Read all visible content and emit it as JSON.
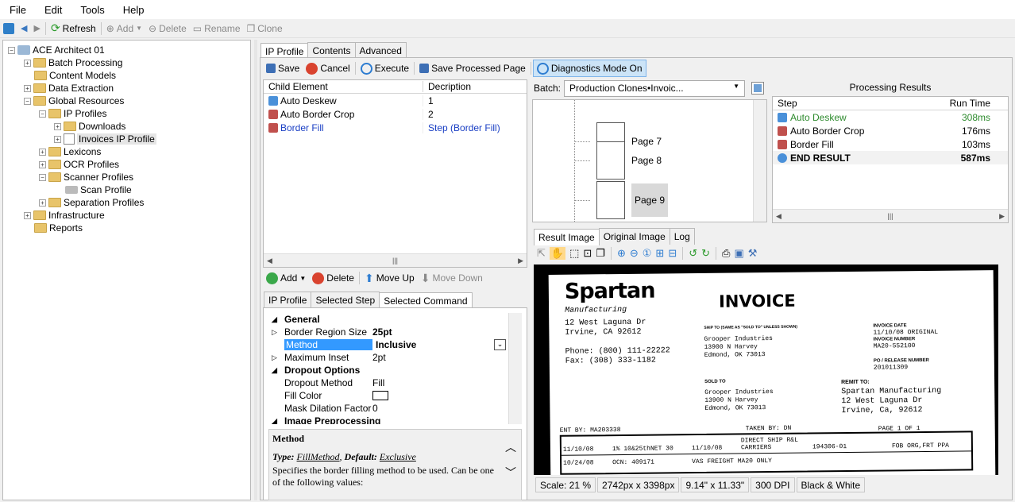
{
  "menu": [
    "File",
    "Edit",
    "Tools",
    "Help"
  ],
  "toolbar": {
    "refresh": "Refresh",
    "add": "Add",
    "delete": "Delete",
    "rename": "Rename",
    "clone": "Clone"
  },
  "tree": {
    "root": "ACE Architect 01",
    "batch": "Batch Processing",
    "content": "Content Models",
    "extraction": "Data Extraction",
    "global": "Global Resources",
    "ipprofiles": "IP Profiles",
    "downloads": "Downloads",
    "invoices": "Invoices IP Profile",
    "lexicons": "Lexicons",
    "ocr": "OCR Profiles",
    "scanner": "Scanner Profiles",
    "scan": "Scan Profile",
    "separation": "Separation Profiles",
    "infra": "Infrastructure",
    "reports": "Reports"
  },
  "main_tabs": [
    "IP Profile",
    "Contents",
    "Advanced"
  ],
  "cmd": {
    "save": "Save",
    "cancel": "Cancel",
    "execute": "Execute",
    "saveproc": "Save Processed Page",
    "diag": "Diagnostics Mode On"
  },
  "steps": {
    "h1": "Child Element",
    "h2": "Decription",
    "rows": [
      [
        "Auto Deskew",
        "1"
      ],
      [
        "Auto Border Crop",
        "2"
      ],
      [
        "Border Fill",
        "Step (Border Fill)"
      ]
    ]
  },
  "stepbtns": {
    "add": "Add",
    "delete": "Delete",
    "up": "Move Up",
    "down": "Move Down"
  },
  "ptabs": [
    "IP Profile",
    "Selected Step",
    "Selected Command"
  ],
  "props": {
    "general": "General",
    "brs": "Border Region Size",
    "brs_v": "25pt",
    "method": "Method",
    "method_v": "Inclusive",
    "mi": "Maximum Inset",
    "mi_v": "2pt",
    "dropout": "Dropout Options",
    "dm": "Dropout Method",
    "dm_v": "Fill",
    "fc": "Fill Color",
    "mdf": "Mask Dilation Factor",
    "mdf_v": "0",
    "ip": "Image Preprocessing"
  },
  "help": {
    "title": "Method",
    "type_lbl": "Type:",
    "type_v": "FillMethod",
    "def_lbl": "Default:",
    "def_v": "Exclusive",
    "text": "Specifies the border filling method to be used. Can be one of the following values:"
  },
  "batch": {
    "label": "Batch:",
    "value": "Production Clones•Invoic...",
    "pages": [
      "Page 7",
      "Page 8",
      "Page 9"
    ]
  },
  "results": {
    "title": "Processing Results",
    "h1": "Step",
    "h2": "Run Time",
    "rows": [
      [
        "Auto Deskew",
        "308ms"
      ],
      [
        "Auto Border Crop",
        "176ms"
      ],
      [
        "Border Fill",
        "103ms"
      ],
      [
        "END RESULT",
        "587ms"
      ]
    ]
  },
  "imgtabs": [
    "Result Image",
    "Original Image",
    "Log"
  ],
  "invoice": {
    "company": "Spartan",
    "sub": "Manufacturing",
    "addr1": "12 West Laguna Dr",
    "addr2": "Irvine, CA 92612",
    "phone": "Phone: (800) 111-22222",
    "fax": "Fax:   (308) 333-1182",
    "title": "INVOICE",
    "shipto": "SHIP TO (SAME AS \"SOLD TO\" UNLESS SHOWN)",
    "ship1": "Grooper Industries",
    "ship2": "13900 N Harvey",
    "ship3": "Edmond, OK 73013",
    "invdate_l": "INVOICE DATE",
    "invdate": "11/10/08 ORIGINAL",
    "invnum_l": "INVOICE NUMBER",
    "invnum": "MA20-552100",
    "po_l": "PO / RELEASE NUMBER",
    "po": "201011309",
    "soldto": "SOLD TO",
    "sold1": "Grooper Industries",
    "sold2": "13900 N Harvey",
    "sold3": "Edmond, OK 73013",
    "remit": "REMIT TO:",
    "rem1": "Spartan Manufacturing",
    "rem2": "12 West Laguna Dr",
    "rem3": "Irvine, Ca, 92612",
    "entby": "ENT BY: MA203338",
    "taken": "TAKEN BY: DN",
    "page": "PAGE 1  OF  1",
    "r1": [
      "11/10/08",
      "1% 10&25thNET 30",
      "11/10/08",
      "DIRECT SHIP R&L CARRIERS",
      "194306-01",
      "FOB ORG,FRT PPA"
    ],
    "r2": [
      "10/24/08",
      "OCN: 409171",
      "VAS FREIGHT  MA20 ONLY"
    ]
  },
  "status": [
    "Scale: 21 %",
    "2742px x 3398px",
    "9.14\" x 11.33\"",
    "300 DPI",
    "Black & White"
  ]
}
